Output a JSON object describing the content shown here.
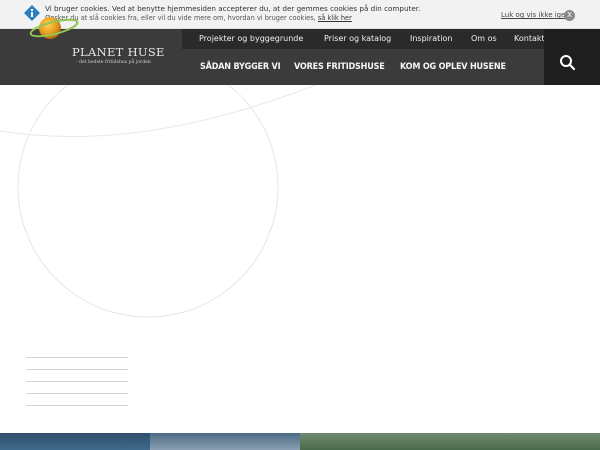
{
  "cookie_bar": {
    "line1": "Vi bruger cookies. Ved at benytte hjemmesiden accepterer du, at der gemmes cookies på din computer.",
    "line2_text": "Ønsker du at slå cookies fra, eller vil du vide mere om, hvordan vi bruger cookies,",
    "line2_link": "så klik her",
    "close_label": "Luk og vis ikke igen",
    "close_x": "X"
  },
  "brand": {
    "name": "PLANET HUSE",
    "tagline": "- det bedste fritidshus på jorden"
  },
  "top_nav": [
    "Projekter og byggegrunde",
    "Priser og katalog",
    "Inspiration",
    "Om os",
    "Kontakt"
  ],
  "main_nav": [
    "SÅDAN BYGGER VI",
    "VORES FRITIDSHUSE",
    "KOM OG OPLEV HUSENE"
  ],
  "icons": {
    "info": "info-icon",
    "search": "search-icon",
    "logo": "planet-logo-icon"
  },
  "colors": {
    "header": "#3b3b3b",
    "top_nav": "#2a2a2a",
    "search": "#1e1e1e",
    "cookie_bar": "#f2f2f2"
  }
}
